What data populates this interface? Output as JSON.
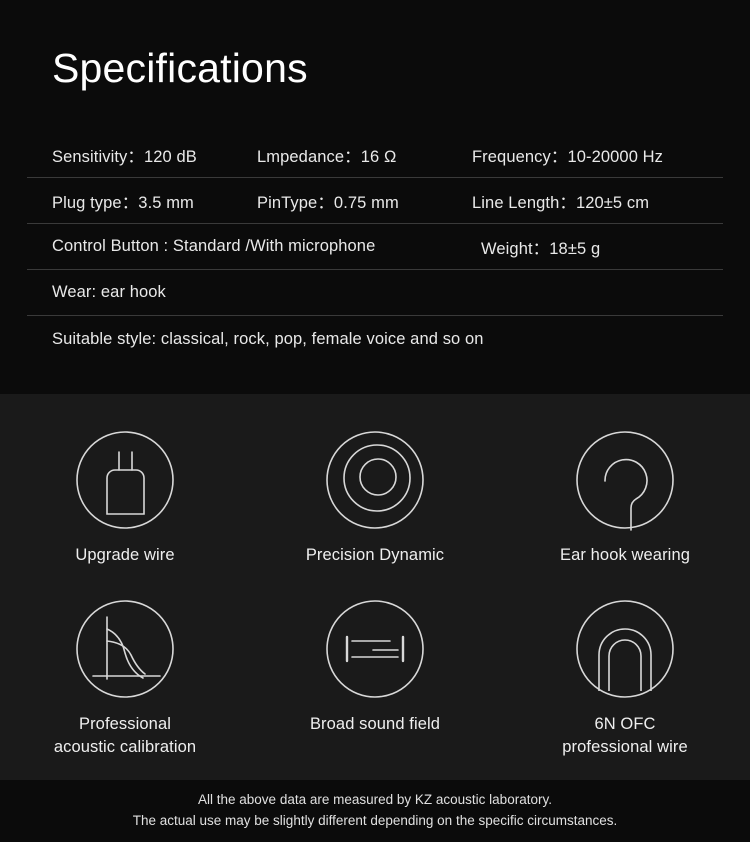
{
  "spec": {
    "title": "Specifications",
    "rows": [
      {
        "cells": [
          "Sensitivity：120 dB",
          "Lmpedance：16 Ω",
          "Frequency：10-20000 Hz"
        ]
      },
      {
        "cells": [
          "Plug type：3.5 mm",
          "PinType：0.75 mm",
          "Line Length：120±5 cm"
        ]
      },
      {
        "cells": [
          "Control Button : Standard /With microphone",
          "Weight：18±5 g"
        ]
      },
      {
        "cells": [
          "Wear: ear hook"
        ]
      },
      {
        "cells": [
          "Suitable style: classical, rock, pop, female voice and so on"
        ]
      }
    ]
  },
  "features": [
    {
      "icon": "plug-icon",
      "label": "Upgrade wire"
    },
    {
      "icon": "concentric-rings-icon",
      "label": "Precision Dynamic"
    },
    {
      "icon": "ear-hook-icon",
      "label": "Ear hook wearing"
    },
    {
      "icon": "frequency-graph-icon",
      "label": "Professional\nacoustic calibration"
    },
    {
      "icon": "sound-field-icon",
      "label": "Broad sound field"
    },
    {
      "icon": "cable-arch-icon",
      "label": "6N OFC\nprofessional wire"
    }
  ],
  "footer": {
    "line1": "All the above data are measured by KZ acoustic laboratory.",
    "line2": "The actual use may be slightly different depending on the specific circumstances."
  },
  "colors": {
    "spec_background": "#0b0b0b",
    "feature_background": "#1a1a1a",
    "text": "#e9e9e9",
    "divider": "#3a3a3a",
    "icon_stroke": "#d8d8d8"
  }
}
